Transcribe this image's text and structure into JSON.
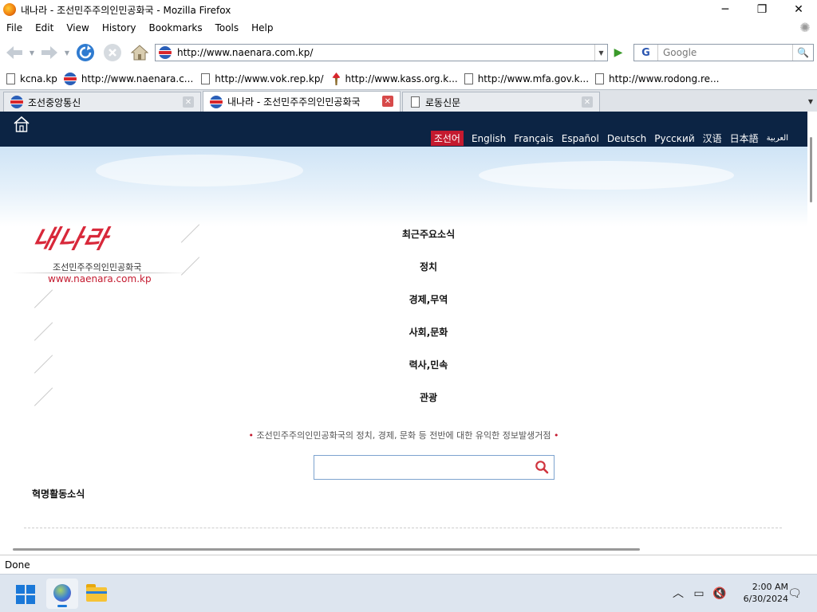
{
  "window": {
    "title": "내나라 - 조선민주주의인민공화국 - Mozilla Firefox",
    "minimize": "─",
    "maximize": "❐",
    "close": "✕"
  },
  "menu": [
    "File",
    "Edit",
    "View",
    "History",
    "Bookmarks",
    "Tools",
    "Help"
  ],
  "toolbar": {
    "url": "http://www.naenara.com.kp/",
    "search_placeholder": "Google",
    "search_engine": "G"
  },
  "bookmarks": [
    {
      "label": "kcna.kp",
      "icon": "page-icon"
    },
    {
      "label": "http://www.naenara.c...",
      "icon": "flag-icon"
    },
    {
      "label": "http://www.vok.rep.kp/",
      "icon": "page-icon"
    },
    {
      "label": "http://www.kass.org.k...",
      "icon": "torch-icon"
    },
    {
      "label": "http://www.mfa.gov.k...",
      "icon": "page-icon"
    },
    {
      "label": "http://www.rodong.re...",
      "icon": "page-icon"
    }
  ],
  "tabs": [
    {
      "label": "조선중앙통신",
      "active": false
    },
    {
      "label": "내나라 - 조선민주주의인민공화국",
      "active": true
    },
    {
      "label": "로동신문",
      "active": false
    }
  ],
  "site": {
    "languages": [
      "조선어",
      "English",
      "Français",
      "Español",
      "Deutsch",
      "Русский",
      "汉语",
      "日本語",
      "العربية"
    ],
    "selected_language": "조선어",
    "logo": {
      "brand": "내나라",
      "subtitle": "조선민주주의인민공화국",
      "url": "www.naenara.com.kp"
    },
    "menu": [
      "최근주요소식",
      "정치",
      "경제,무역",
      "사회,문화",
      "력사,민속",
      "관광"
    ],
    "tagline": "조선민주주의인민공화국의 정치, 경제, 문화 등 전반에 대한 유익한 정보발생거점",
    "section_title": "혁명활동소식"
  },
  "status": "Done",
  "taskbar": {
    "time": "2:00 AM",
    "date": "6/30/2024"
  },
  "colors": {
    "header_bg": "#0c2444",
    "accent_red": "#c41a2f",
    "search_border": "#7da3cf"
  }
}
